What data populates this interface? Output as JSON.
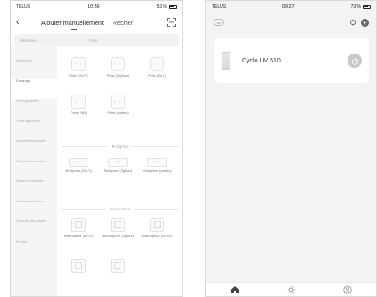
{
  "left": {
    "status": {
      "carrier": "TELUS",
      "time": "10:56",
      "battery": "53 %"
    },
    "topbar": {
      "tab_add": "Ajouter manuellement",
      "tab_search": "Recher"
    },
    "search": {
      "placeholder": "Electricien",
      "category": "Prise"
    },
    "sidebar": [
      {
        "label": "Electricien",
        "active": false
      },
      {
        "label": "Eclairage",
        "active": true
      },
      {
        "label": "Gros appareils...",
        "active": false
      },
      {
        "label": "Petits appareils...",
        "active": false
      },
      {
        "label": "Appareil électromé...",
        "active": false
      },
      {
        "label": "Sécurité et capteurs",
        "active": false
      },
      {
        "label": "Santé et exercice",
        "active": false
      },
      {
        "label": "Vidéosurveillance",
        "active": false
      },
      {
        "label": "Contrôle de passer...",
        "active": false
      },
      {
        "label": "Energy",
        "active": false
      }
    ],
    "sections": {
      "sockets": "Prise",
      "strips": "Multiprise",
      "switches": "Interrupteur"
    },
    "sockets": [
      {
        "label": "Prise (Wi-Fi)"
      },
      {
        "label": "Prise (ZigBee)"
      },
      {
        "label": "Prise (BLE)"
      },
      {
        "label": "Prise (NB)"
      },
      {
        "label": "Prise (autres)"
      }
    ],
    "strips": [
      {
        "label": "Multiprise (Wi-Fi)"
      },
      {
        "label": "Multiprise (ZigBee)"
      },
      {
        "label": "Multiprise (autres)"
      }
    ],
    "switches": [
      {
        "label": "Interrupteur (Wi-Fi)"
      },
      {
        "label": "Interrupteur (ZigBee)"
      },
      {
        "label": "Interrupteur (GPRS)"
      }
    ]
  },
  "right": {
    "status": {
      "carrier": "TELUS",
      "time": "09:27",
      "battery": "73 %"
    },
    "device": {
      "name": "Cyclo UV 510"
    },
    "colors": {
      "power": "#c9c9c9",
      "background": "#f3f3f3"
    }
  }
}
